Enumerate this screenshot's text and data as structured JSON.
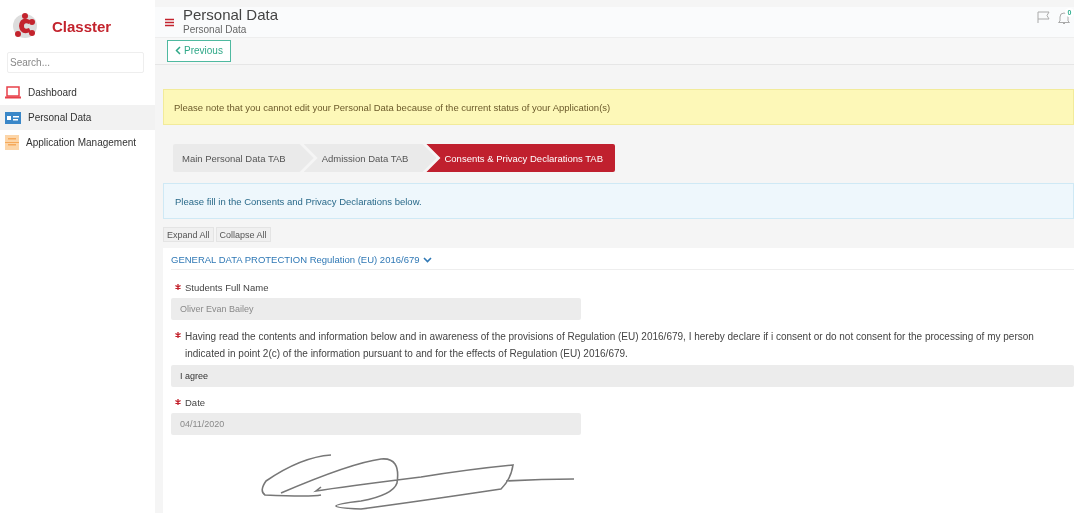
{
  "sidebar": {
    "logo": "Classter",
    "search": {
      "placeholder": "Search..."
    },
    "items": [
      {
        "label": "Dashboard",
        "selected": false
      },
      {
        "label": "Personal Data",
        "selected": true
      },
      {
        "label": "Application Management",
        "selected": false
      }
    ]
  },
  "header": {
    "title": "Personal Data",
    "breadcrumb": "Personal Data",
    "notifications": "0"
  },
  "previous_button": "Previous",
  "notice": "Please note that you cannot edit your Personal Data because of the current status of your Application(s)",
  "tabs": [
    {
      "label": "Main Personal Data TAB",
      "selected": false
    },
    {
      "label": "Admission Data TAB",
      "selected": false
    },
    {
      "label": "Consents & Privacy Declarations TAB",
      "selected": true
    }
  ],
  "info": "Please fill in the Consents and Privacy Declarations below.",
  "expand_buttons": [
    "Expand All",
    "Collapse All"
  ],
  "section": {
    "title": "GENERAL DATA PROTECTION Regulation (EU) 2016/679",
    "expanded": true,
    "fields": [
      {
        "kind": "short",
        "label": "Students Full Name",
        "required": true,
        "value": "Oliver Evan Bailey",
        "disabled": true
      },
      {
        "kind": "wide",
        "label": "Having read the contents and information below and in awareness of the provisions of Regulation (EU) 2016/679, I hereby declare if i consent or do not consent for the processing of my person\nindicated in point 2(c) of the information pursuant to and for the effects of Regulation (EU) 2016/679.",
        "required": true,
        "value": "I agree",
        "disabled": false
      },
      {
        "kind": "short",
        "label": "Date",
        "required": true,
        "value": "04/11/2020",
        "disabled": true
      }
    ]
  }
}
